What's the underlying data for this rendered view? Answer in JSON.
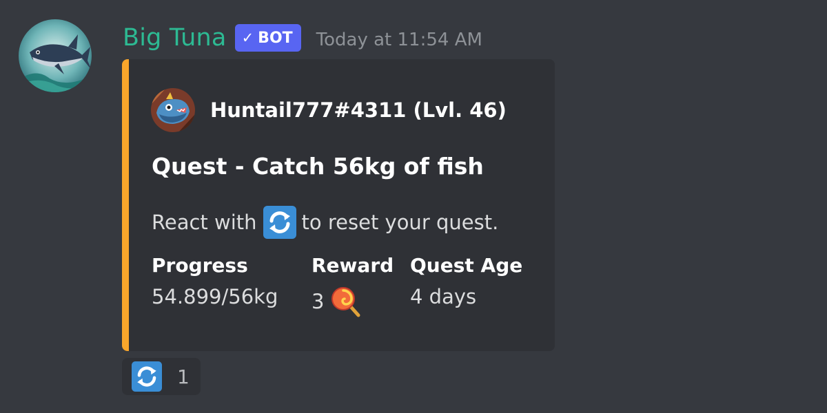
{
  "message": {
    "username": "Big Tuna",
    "bot_tag": "BOT",
    "timestamp": "Today at 11:54 AM",
    "avatar_icon": "tuna-avatar-icon"
  },
  "embed": {
    "accent_color": "#f9a62b",
    "author": {
      "name": "Huntail777#4311 (Lvl. 46)",
      "icon": "huntail-avatar-icon"
    },
    "title": "Quest - Catch 56kg of fish",
    "description": {
      "before_emoji": "React with",
      "emoji": "arrows-counterclockwise-icon",
      "after_emoji": "to reset your quest."
    },
    "fields": [
      {
        "name": "Progress",
        "value": "54.899/56kg"
      },
      {
        "name": "Reward",
        "value": "3",
        "emoji": "lollipop-icon"
      },
      {
        "name": "Quest Age",
        "value": "4 days"
      }
    ]
  },
  "reaction": {
    "emoji": "arrows-counterclockwise-icon",
    "count": "1"
  },
  "colors": {
    "background": "#36393f",
    "embed_background": "#2f3136",
    "username": "#2dba93",
    "bot_tag": "#5865f2"
  }
}
